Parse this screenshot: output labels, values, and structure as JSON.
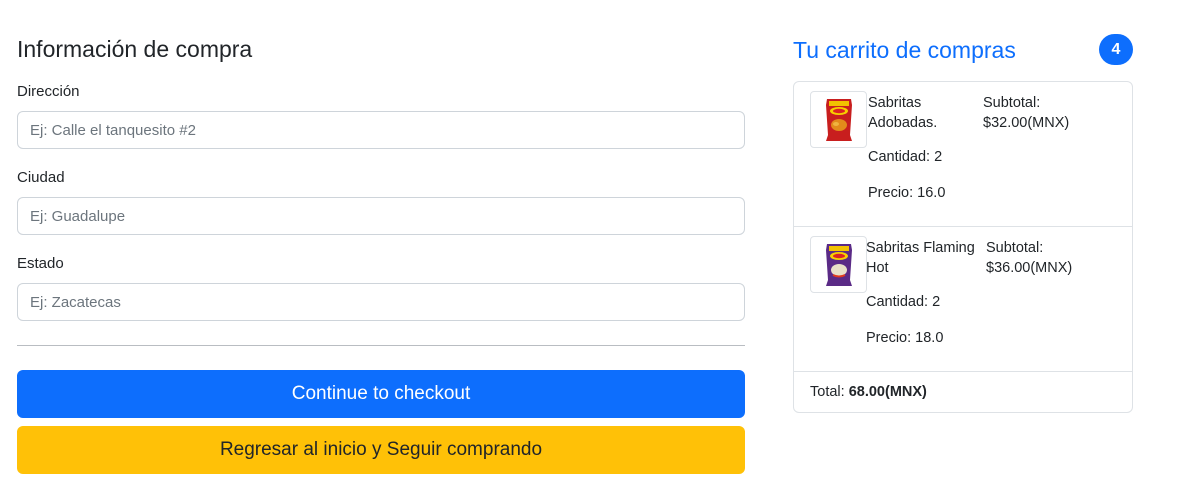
{
  "form": {
    "title": "Información de compra",
    "fields": [
      {
        "label": "Dirección",
        "placeholder": "Ej: Calle el tanquesito #2",
        "value": ""
      },
      {
        "label": "Ciudad",
        "placeholder": "Ej: Guadalupe",
        "value": ""
      },
      {
        "label": "Estado",
        "placeholder": "Ej: Zacatecas",
        "value": ""
      }
    ],
    "checkout_label": "Continue to checkout",
    "back_label": "Regresar al inicio y Seguir comprando"
  },
  "cart": {
    "title": "Tu carrito de compras",
    "count": "4",
    "items": [
      {
        "name_line1": "Sabritas",
        "name_line2": "Adobadas.",
        "subtotal_label": "Subtotal:",
        "subtotal_value": "$32.00(MNX)",
        "quantity": "Cantidad: 2",
        "price": "Precio: 16.0",
        "icon": "red-chips-bag-icon"
      },
      {
        "name_line1": "Sabritas Flaming",
        "name_line2": "Hot",
        "subtotal_label": "Subtotal:",
        "subtotal_value": "$36.00(MNX)",
        "quantity": "Cantidad: 2",
        "price": "Precio: 18.0",
        "icon": "purple-chips-bag-icon"
      }
    ],
    "total_label": "Total:",
    "total_value": "68.00(MNX)"
  },
  "colors": {
    "primary": "#0d6efd",
    "warning": "#ffc107",
    "border": "#dee2e6"
  }
}
